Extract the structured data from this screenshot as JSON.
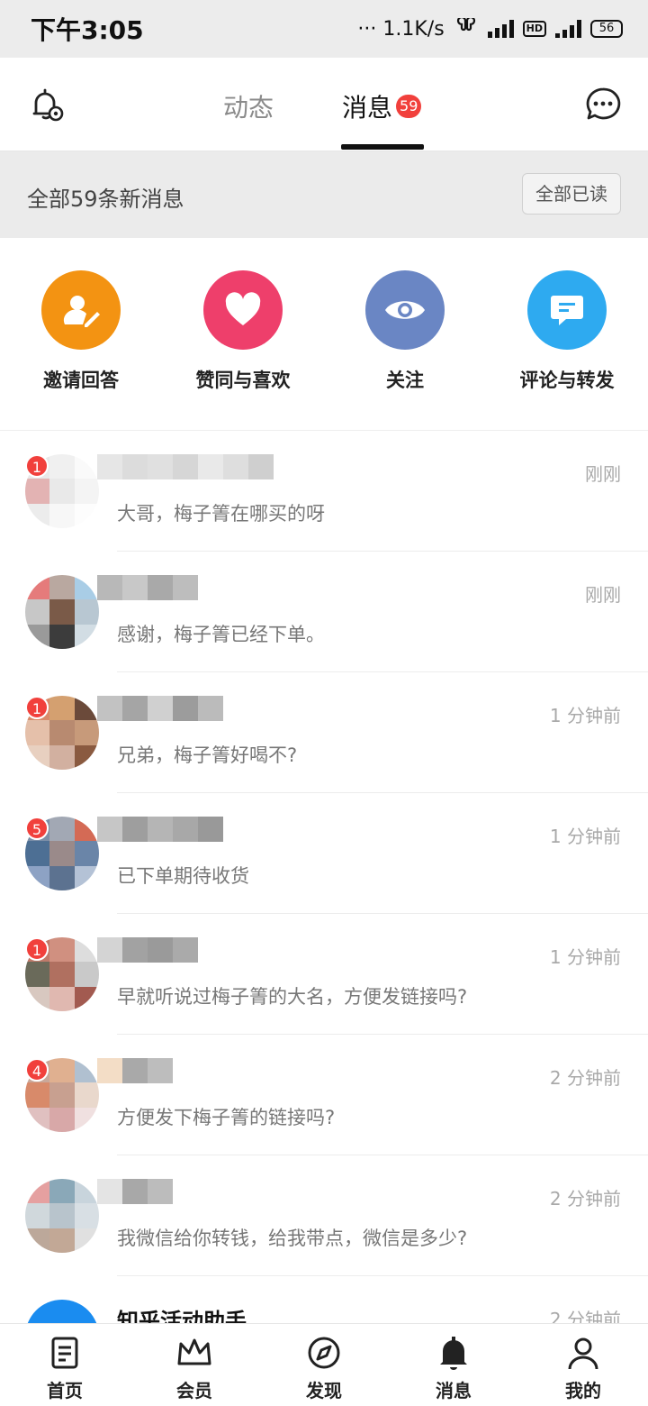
{
  "status_bar": {
    "time": "下午3:05",
    "network_speed": "··· 1.1K/s",
    "hd_label": "HD",
    "battery": "56"
  },
  "top_nav": {
    "tabs": [
      {
        "label": "动态",
        "active": false
      },
      {
        "label": "消息",
        "active": true,
        "badge": "59"
      }
    ]
  },
  "summary": {
    "text": "全部59条新消息",
    "mark_all_read": "全部已读"
  },
  "categories": [
    {
      "label": "邀请回答",
      "icon": "person-edit-icon",
      "color": "#f39312"
    },
    {
      "label": "赞同与喜欢",
      "icon": "heart-icon",
      "color": "#ee3f6b"
    },
    {
      "label": "关注",
      "icon": "eye-icon",
      "color": "#6a86c4"
    },
    {
      "label": "评论与转发",
      "icon": "comment-icon",
      "color": "#2eaaf0"
    }
  ],
  "messages": [
    {
      "badge": "1",
      "time": "刚刚",
      "preview": "大哥，梅子箐在哪买的呀"
    },
    {
      "badge": "",
      "time": "刚刚",
      "preview": "感谢，梅子箐已经下单。"
    },
    {
      "badge": "1",
      "time": "1 分钟前",
      "preview": "兄弟，梅子箐好喝不?"
    },
    {
      "badge": "5",
      "time": "1 分钟前",
      "preview": "已下单期待收货"
    },
    {
      "badge": "1",
      "time": "1 分钟前",
      "preview": "早就听说过梅子箐的大名，方便发链接吗?"
    },
    {
      "badge": "4",
      "time": "2 分钟前",
      "preview": "方便发下梅子箐的链接吗?"
    },
    {
      "badge": "",
      "time": "2 分钟前",
      "preview": "我微信给你转钱，给我带点，微信是多少?"
    },
    {
      "badge": "",
      "time": "2 分钟前",
      "title": "知乎活动助手",
      "preview": ""
    }
  ],
  "bottom_nav": [
    {
      "label": "首页",
      "icon": "home-icon"
    },
    {
      "label": "会员",
      "icon": "crown-icon"
    },
    {
      "label": "发现",
      "icon": "compass-icon"
    },
    {
      "label": "消息",
      "icon": "bell-icon",
      "active": true
    },
    {
      "label": "我的",
      "icon": "profile-icon"
    }
  ]
}
